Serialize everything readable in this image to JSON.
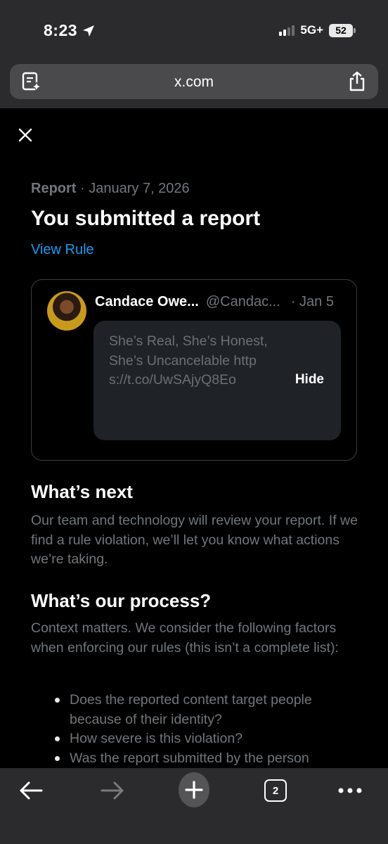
{
  "status_bar": {
    "time": "8:23",
    "network": "5G+",
    "battery": "52"
  },
  "browser": {
    "url": "x.com",
    "tab_count": "2",
    "icons": {
      "reader": "reader-mode-icon",
      "share": "share-icon",
      "back": "back-arrow-icon",
      "forward": "forward-arrow-icon",
      "new_tab": "plus-icon",
      "tabs": "tabs-icon",
      "more": "more-icon"
    }
  },
  "report": {
    "label": "Report",
    "separator": " · ",
    "date": "January 7, 2026",
    "title": "You submitted a report",
    "view_rule": "View Rule"
  },
  "post": {
    "name": "Candace Owe...",
    "handle": "@Candac...",
    "date": "· Jan 5",
    "text": "She’s Real, She’s Honest, She’s Uncancelable https://t.co/UwSAjyQ8Eo",
    "hide_label": "Hide"
  },
  "whats_next": {
    "heading": "What’s next",
    "body": "Our team and technology will review your report. If we find a rule violation, we’ll let you know what actions we’re taking."
  },
  "process": {
    "heading": "What’s our process?",
    "body": "Context matters. We consider the following factors when enforcing our rules (this isn’t a complete list):",
    "items": [
      "Does the reported content target people because of their identity?",
      "How severe is this violation?",
      "Was the report submitted by the person"
    ]
  },
  "colors": {
    "accent": "#1d9bf0",
    "muted": "#71767b",
    "chrome": "#2b2b2d"
  }
}
